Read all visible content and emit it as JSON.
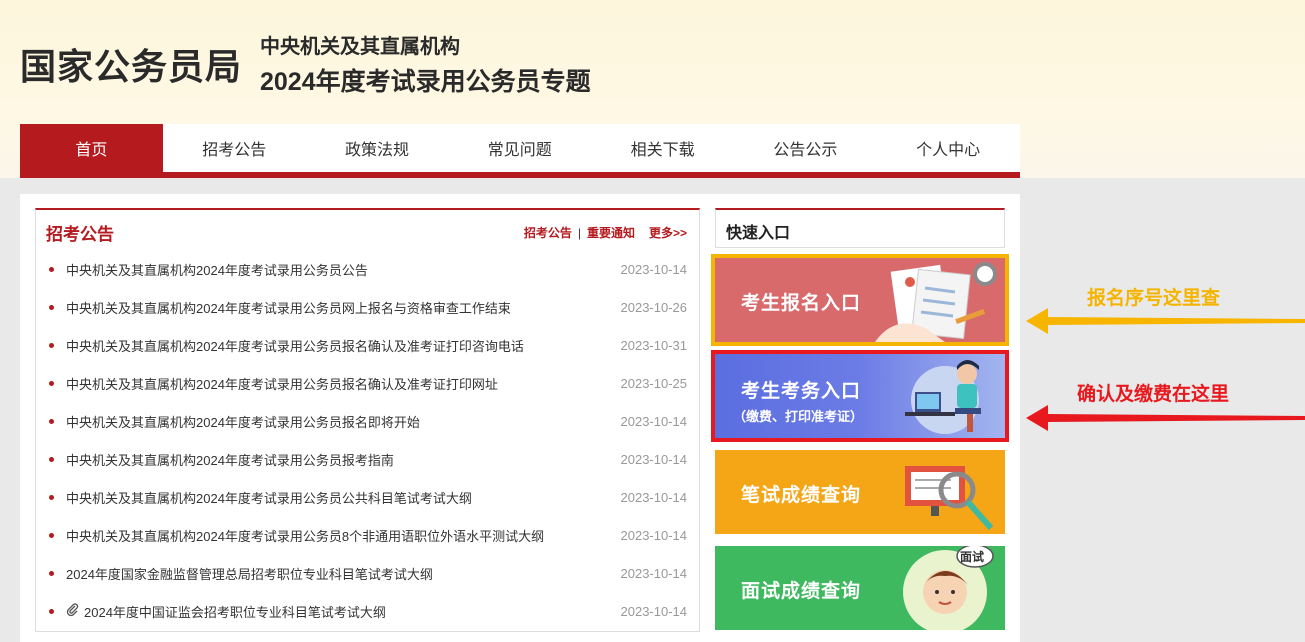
{
  "header": {
    "logo": "国家公务员局",
    "subtitle1": "中央机关及其直属机构",
    "subtitle2": "2024年度考试录用公务员专题"
  },
  "nav": [
    "首页",
    "招考公告",
    "政策法规",
    "常见问题",
    "相关下载",
    "公告公示",
    "个人中心"
  ],
  "notice": {
    "title": "招考公告",
    "link1": "招考公告",
    "sep": "|",
    "link2": "重要通知",
    "more": "更多>>",
    "items": [
      {
        "title": "中央机关及其直属机构2024年度考试录用公务员公告",
        "date": "2023-10-14"
      },
      {
        "title": "中央机关及其直属机构2024年度考试录用公务员网上报名与资格审查工作结束",
        "date": "2023-10-26"
      },
      {
        "title": "中央机关及其直属机构2024年度考试录用公务员报名确认及准考证打印咨询电话",
        "date": "2023-10-31"
      },
      {
        "title": "中央机关及其直属机构2024年度考试录用公务员报名确认及准考证打印网址",
        "date": "2023-10-25"
      },
      {
        "title": "中央机关及其直属机构2024年度考试录用公务员报名即将开始",
        "date": "2023-10-14"
      },
      {
        "title": "中央机关及其直属机构2024年度考试录用公务员报考指南",
        "date": "2023-10-14"
      },
      {
        "title": "中央机关及其直属机构2024年度考试录用公务员公共科目笔试考试大纲",
        "date": "2023-10-14"
      },
      {
        "title": "中央机关及其直属机构2024年度考试录用公务员8个非通用语职位外语水平测试大纲",
        "date": "2023-10-14"
      },
      {
        "title": "2024年度国家金融监督管理总局招考职位专业科目笔试考试大纲",
        "date": "2023-10-14"
      },
      {
        "title": "2024年度中国证监会招考职位专业科目笔试考试大纲",
        "date": "2023-10-14"
      }
    ]
  },
  "quick": {
    "title": "快速入口",
    "card1": "考生报名入口",
    "card2": "考生考务入口",
    "card2_sub": "（缴费、打印准考证）",
    "card3": "笔试成绩查询",
    "card4": "面试成绩查询",
    "interview_tag": "面试"
  },
  "annotations": {
    "a1": "报名序号这里查",
    "a2": "确认及缴费在这里"
  }
}
